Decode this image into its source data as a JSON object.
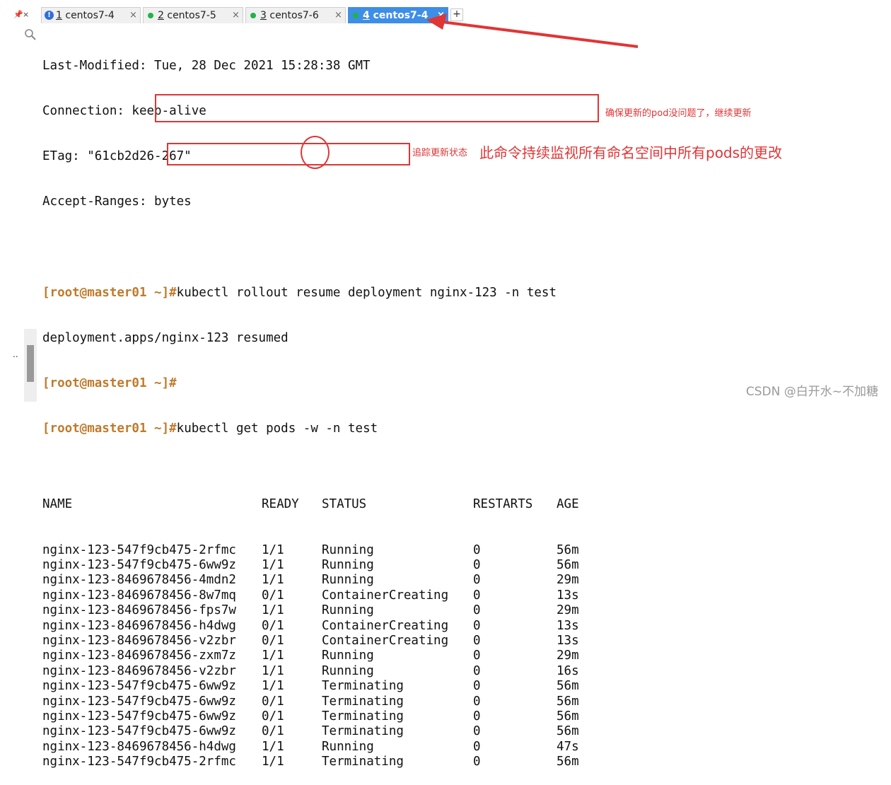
{
  "tabs": [
    {
      "num": "1",
      "label": " centos7-4",
      "status": "info",
      "active": false
    },
    {
      "num": "2",
      "label": " centos7-5",
      "status": "connected",
      "active": false
    },
    {
      "num": "3",
      "label": " centos7-6",
      "status": "connected",
      "active": false
    },
    {
      "num": "4",
      "label": " centos7-4",
      "status": "connected",
      "active": true
    }
  ],
  "tabbar": {
    "pin_icon": "pin-icon",
    "close_symbol": "×",
    "add_symbol": "+"
  },
  "terminal": {
    "headers": [
      "Last-Modified: Tue, 28 Dec 2021 15:28:38 GMT",
      "Connection: keep-alive",
      "ETag: \"61cb2d26-267\"",
      "Accept-Ranges: bytes"
    ],
    "prompt": "[root@master01 ~]#",
    "cmd1": "kubectl rollout resume deployment nginx-123 -n test",
    "out1": "deployment.apps/nginx-123 resumed",
    "cmd2_a": "kubectl get pods ",
    "cmd2_flag": "-w",
    "cmd2_b": " -n test",
    "table_headers": [
      "NAME",
      "READY",
      "STATUS",
      "RESTARTS",
      "AGE"
    ],
    "pods": [
      [
        "nginx-123-547f9cb475-2rfmc",
        "1/1",
        "Running",
        "0",
        "56m"
      ],
      [
        "nginx-123-547f9cb475-6ww9z",
        "1/1",
        "Running",
        "0",
        "56m"
      ],
      [
        "nginx-123-8469678456-4mdn2",
        "1/1",
        "Running",
        "0",
        "29m"
      ],
      [
        "nginx-123-8469678456-8w7mq",
        "0/1",
        "ContainerCreating",
        "0",
        "13s"
      ],
      [
        "nginx-123-8469678456-fps7w",
        "1/1",
        "Running",
        "0",
        "29m"
      ],
      [
        "nginx-123-8469678456-h4dwg",
        "0/1",
        "ContainerCreating",
        "0",
        "13s"
      ],
      [
        "nginx-123-8469678456-v2zbr",
        "0/1",
        "ContainerCreating",
        "0",
        "13s"
      ],
      [
        "nginx-123-8469678456-zxm7z",
        "1/1",
        "Running",
        "0",
        "29m"
      ],
      [
        "nginx-123-8469678456-v2zbr",
        "1/1",
        "Running",
        "0",
        "16s"
      ],
      [
        "nginx-123-547f9cb475-6ww9z",
        "1/1",
        "Terminating",
        "0",
        "56m"
      ],
      [
        "nginx-123-547f9cb475-6ww9z",
        "0/1",
        "Terminating",
        "0",
        "56m"
      ],
      [
        "nginx-123-547f9cb475-6ww9z",
        "0/1",
        "Terminating",
        "0",
        "56m"
      ],
      [
        "nginx-123-547f9cb475-6ww9z",
        "0/1",
        "Terminating",
        "0",
        "56m"
      ],
      [
        "nginx-123-8469678456-h4dwg",
        "1/1",
        "Running",
        "0",
        "47s"
      ],
      [
        "nginx-123-547f9cb475-2rfmc",
        "1/1",
        "Terminating",
        "0",
        "56m"
      ]
    ]
  },
  "annotations": {
    "note1": "确保更新的pod没问题了，继续更新",
    "note2": "追踪更新状态",
    "note3": "此命令持续监视所有命名空间中所有pods的更改"
  },
  "watermark": "CSDN @白开水~不加糖",
  "colors": {
    "prompt": "#c07a2b",
    "annotation": "#e03535",
    "active_tab": "#3d8ee6",
    "status_dot": "#21b24b"
  }
}
